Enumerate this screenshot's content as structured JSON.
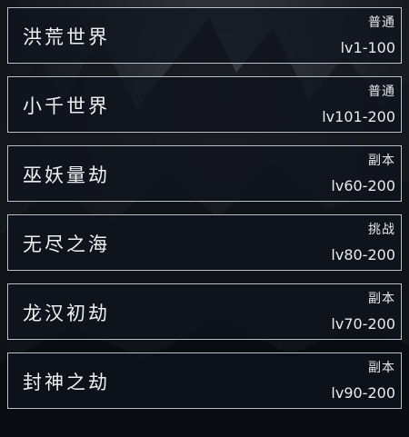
{
  "realms": [
    {
      "name": "洪荒世界",
      "type": "普通",
      "level": "lv1-100"
    },
    {
      "name": "小千世界",
      "type": "普通",
      "level": "lv101-200"
    },
    {
      "name": "巫妖量劫",
      "type": "副本",
      "level": "lv60-200"
    },
    {
      "name": "无尽之海",
      "type": "挑战",
      "level": "lv80-200"
    },
    {
      "name": "龙汉初劫",
      "type": "副本",
      "level": "lv70-200"
    },
    {
      "name": "封神之劫",
      "type": "副本",
      "level": "lv90-200"
    }
  ]
}
